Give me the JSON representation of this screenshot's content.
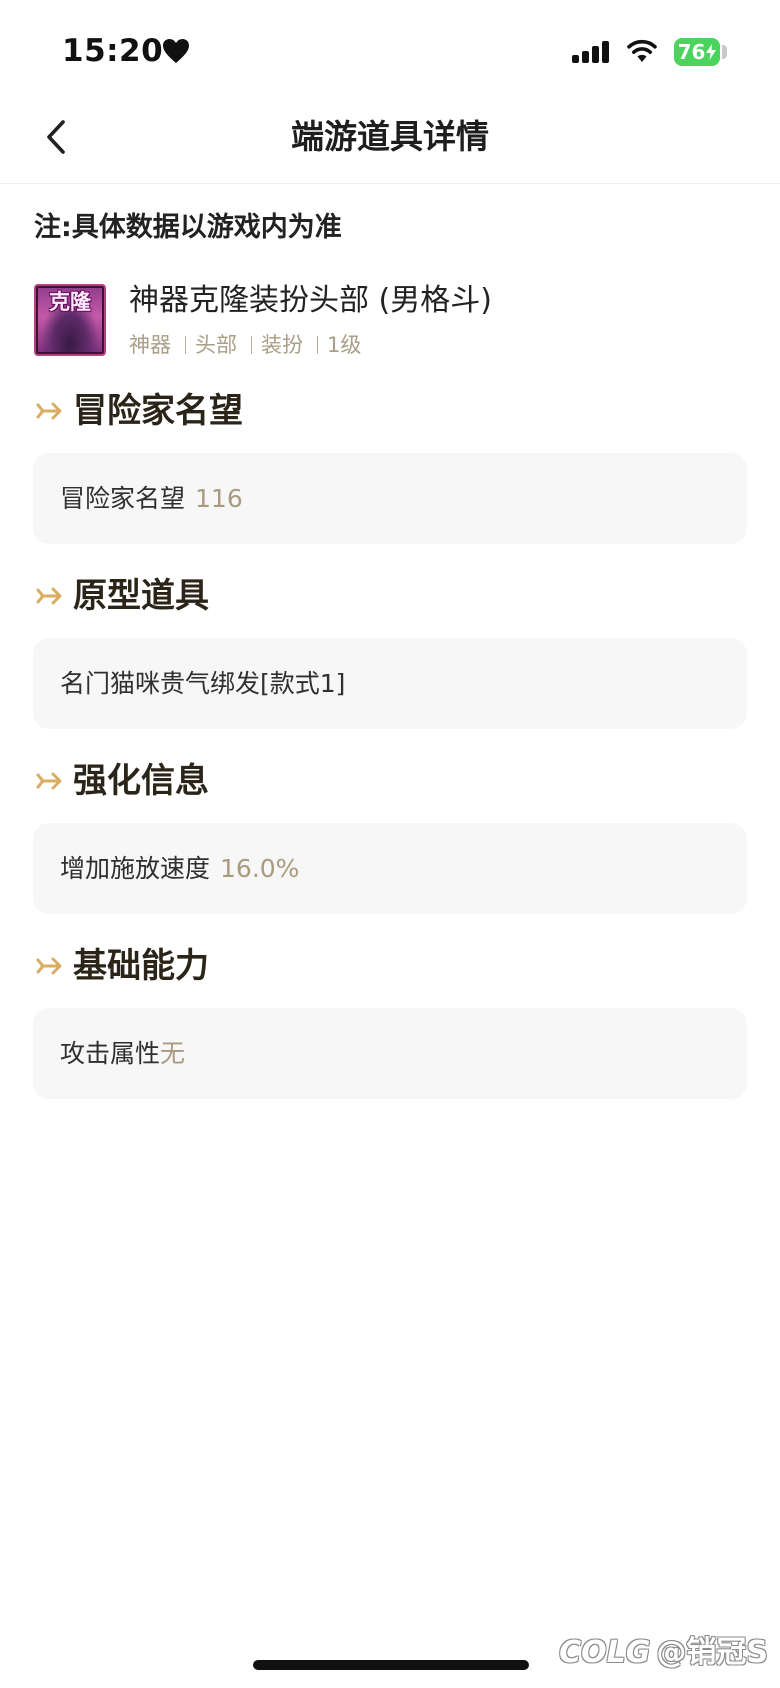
{
  "status_bar": {
    "time": "15:20",
    "battery": "76",
    "icons": [
      "heart-icon",
      "signal-icon",
      "wifi-icon",
      "battery-icon"
    ]
  },
  "nav": {
    "title": "端游道具详情",
    "back_icon": "chevron-left-icon"
  },
  "note": "注:具体数据以游戏内为准",
  "item": {
    "icon_text": "克隆",
    "name": "神器克隆装扮头部 (男格斗)",
    "tags": [
      "神器",
      "头部",
      "装扮",
      "1级"
    ]
  },
  "sections": [
    {
      "title": "冒险家名望",
      "label": "冒险家名望",
      "value": "116"
    },
    {
      "title": "原型道具",
      "label": "名门猫咪贵气绑发[款式1]"
    },
    {
      "title": "强化信息",
      "label": "增加施放速度",
      "value": "16.0%"
    },
    {
      "title": "基础能力",
      "label": "攻击属性",
      "value": "无"
    }
  ],
  "section_icon": "arrow-right-icon",
  "watermark": {
    "brand": "COLG",
    "handle": "@销冠S"
  },
  "colors": {
    "accent_gold": "#d9ad62",
    "value_tan": "#a89b7e",
    "card_bg": "#f7f7f7",
    "battery_green": "#4cd35d"
  }
}
